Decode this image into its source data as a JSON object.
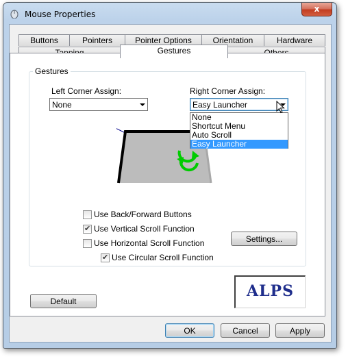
{
  "window": {
    "title": "Mouse Properties",
    "close_glyph": "x"
  },
  "tabs": {
    "row1": [
      "Buttons",
      "Pointers",
      "Pointer Options",
      "Orientation",
      "Hardware"
    ],
    "row2": [
      "Tapping",
      "Gestures",
      "Others"
    ],
    "selected": "Gestures"
  },
  "gestures": {
    "group_label": "Gestures",
    "left_corner": {
      "label": "Left Corner Assign:",
      "value": "None"
    },
    "right_corner": {
      "label": "Right Corner Assign:",
      "value": "Easy Launcher",
      "options": [
        "None",
        "Shortcut Menu",
        "Auto Scroll",
        "Easy Launcher"
      ],
      "highlighted": "Easy Launcher"
    },
    "checkboxes": [
      {
        "label": "Use Back/Forward Buttons",
        "checked": false
      },
      {
        "label": "Use Vertical Scroll Function",
        "checked": true
      },
      {
        "label": "Use Horizontal Scroll Function",
        "checked": false
      },
      {
        "label": "Use Circular Scroll Function",
        "checked": true
      }
    ],
    "settings_button": "Settings..."
  },
  "default_button": "Default",
  "logo_text": "ALPS",
  "footer": {
    "ok": "OK",
    "cancel": "Cancel",
    "apply": "Apply"
  },
  "colors": {
    "accent": "#3399ff",
    "logo": "#1f2e8c",
    "touchpad_arrow": "#00cc00"
  },
  "icons": [
    "mouse-icon",
    "close-icon",
    "chevron-down-icon",
    "circular-scroll-icon",
    "pointer-cursor-icon"
  ]
}
